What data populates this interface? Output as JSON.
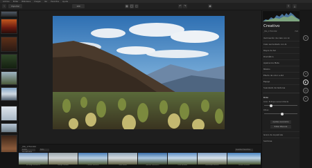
{
  "menu": [
    "Archivo",
    "Editar",
    "Biblioteca",
    "Imagen",
    "Ver",
    "Favoritos",
    "Ayuda"
  ],
  "toolbar": {
    "import_label": "Importar",
    "zoom": "100",
    "icon_names": [
      "back-icon",
      "grid-icon",
      "single-view-icon",
      "compare-icon",
      "undo-icon",
      "redo-icon",
      "eye-icon",
      "share-icon",
      "export-icon"
    ]
  },
  "panel": {
    "title": "Creativo",
    "file": "_MG_1750.CR2",
    "iso": "ISO",
    "items": [
      "Iluminación de cielo con AI",
      "Cielo aumentado con AI",
      "Rayos de Sol",
      "Dramático",
      "Apariencia Mate",
      "Místico",
      "Efecto de color a AI2",
      "Espejo",
      "Suavizado de texturas"
    ],
    "section_title": "Brillo",
    "slider1_label": "Color: Enfoque suave brillante",
    "slider1_value": 0.18,
    "slider2_label": "Difuso",
    "slider2_value": 0.55,
    "button1": "Ajustes avanzados",
    "button2": "Editar Máscara",
    "footer_items": [
      "Grano de la película",
      "Sombras"
    ]
  },
  "filmstrip": {
    "folder": "_MG_1750.CR2",
    "dropdown1": "Looks Ancestrales",
    "dropdown2": "Todo",
    "dropdown3": "Guardar favoritos",
    "captions": [
      "AI Image Enhancer",
      "Paisaje Dorado",
      "Colores intensos",
      "Tono cálido",
      "Natural Dramático",
      "Cielo azulado",
      "Recuerdos bonitos",
      "Verano soleado"
    ]
  },
  "colors": {
    "accent": "#2f9cd6",
    "panel_bg": "#1f1f1f",
    "canvas_bg": "#1e1e1e"
  }
}
